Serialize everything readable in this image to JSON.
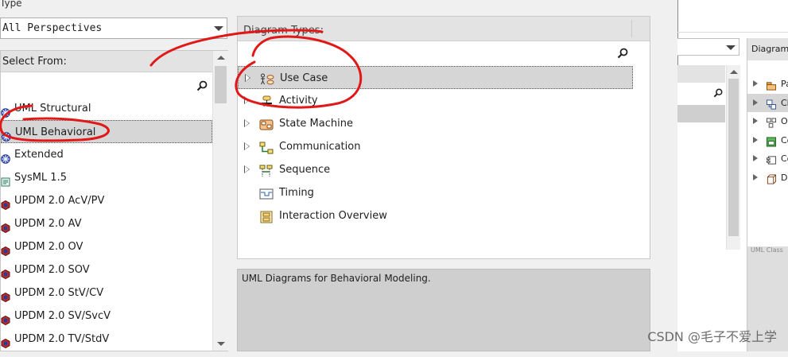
{
  "type_section": {
    "label": "Type",
    "perspective_value": "All Perspectives"
  },
  "select_from": {
    "header": "Select From:",
    "items": [
      {
        "label": "UML Structural",
        "icon": "uml-globe-icon",
        "selected": false
      },
      {
        "label": "UML Behavioral",
        "icon": "uml-globe-icon",
        "selected": true
      },
      {
        "label": "Extended",
        "icon": "uml-globe-icon",
        "selected": false
      },
      {
        "label": "SysML 1.5",
        "icon": "sysml-icon",
        "selected": false
      },
      {
        "label": "UPDM 2.0 AcV/PV",
        "icon": "updm-hexagon-icon",
        "selected": false
      },
      {
        "label": "UPDM 2.0 AV",
        "icon": "updm-hexagon-icon",
        "selected": false
      },
      {
        "label": "UPDM 2.0 OV",
        "icon": "updm-hexagon-icon",
        "selected": false
      },
      {
        "label": "UPDM 2.0 SOV",
        "icon": "updm-hexagon-icon",
        "selected": false
      },
      {
        "label": "UPDM 2.0 StV/CV",
        "icon": "updm-hexagon-icon",
        "selected": false
      },
      {
        "label": "UPDM 2.0 SV/SvcV",
        "icon": "updm-hexagon-icon",
        "selected": false
      },
      {
        "label": "UPDM 2.0 TV/StdV",
        "icon": "updm-hexagon-icon",
        "selected": false
      }
    ]
  },
  "diagram_types": {
    "header": "Diagram Types:",
    "items": [
      {
        "label": "Use Case",
        "icon": "use-case-diagram-icon",
        "expandable": true,
        "selected": true
      },
      {
        "label": "Activity",
        "icon": "activity-diagram-icon",
        "expandable": true,
        "selected": false
      },
      {
        "label": "State Machine",
        "icon": "state-machine-diagram-icon",
        "expandable": true,
        "selected": false
      },
      {
        "label": "Communication",
        "icon": "communication-diagram-icon",
        "expandable": true,
        "selected": false
      },
      {
        "label": "Sequence",
        "icon": "sequence-diagram-icon",
        "expandable": true,
        "selected": false
      },
      {
        "label": "Timing",
        "icon": "timing-diagram-icon",
        "expandable": false,
        "selected": false
      },
      {
        "label": "Interaction Overview",
        "icon": "interaction-overview-diagram-icon",
        "expandable": false,
        "selected": false
      }
    ]
  },
  "description": {
    "text": "UML Diagrams for Behavioral Modeling."
  },
  "background_window": {
    "diagram_header": "Diagram",
    "items": [
      {
        "label": "Pa",
        "icon": "package-icon",
        "selected": false
      },
      {
        "label": "Cl",
        "icon": "class-icon",
        "selected": true
      },
      {
        "label": "Ol",
        "icon": "object-icon",
        "selected": false
      },
      {
        "label": "Co",
        "icon": "composite-icon",
        "selected": false
      },
      {
        "label": "Co",
        "icon": "component-icon",
        "selected": false
      },
      {
        "label": "De",
        "icon": "deployment-icon",
        "selected": false
      }
    ],
    "description_fragment": "UML Class"
  },
  "watermark": "CSDN @毛子不爱上学",
  "colors": {
    "annotation_red": "#e01818",
    "selection_gray": "#d6d6d6",
    "header_gray": "#e3e3e3"
  }
}
